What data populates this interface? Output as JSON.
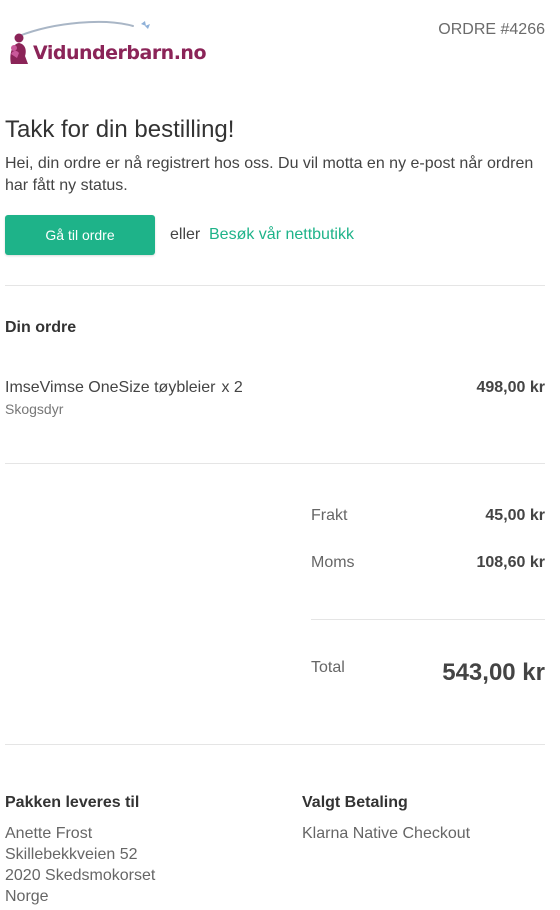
{
  "header": {
    "logo_text": "Vidunderbarn.no",
    "order_number": "ORDRE #4266"
  },
  "intro": {
    "title": "Takk for din bestilling!",
    "message": "Hei, din ordre er nå registrert hos oss. Du vil motta en ny e-post når ordren har fått ny status.",
    "button_label": "Gå til ordre",
    "or_text": "eller",
    "shop_link_label": "Besøk vår nettbutikk"
  },
  "order": {
    "section_title": "Din ordre",
    "items": [
      {
        "name": "ImseVimse OneSize tøybleier",
        "quantity": "x 2",
        "variant": "Skogsdyr",
        "price": "498,00 kr"
      }
    ]
  },
  "summary": {
    "shipping_label": "Frakt",
    "shipping_value": "45,00 kr",
    "vat_label": "Moms",
    "vat_value": "108,60 kr",
    "total_label": "Total",
    "total_value": "543,00 kr"
  },
  "shipping_address": {
    "title": "Pakken leveres til",
    "lines": [
      "Anette Frost",
      "Skillebekkveien 52",
      "2020 Skedsmokorset",
      "Norge"
    ]
  },
  "payment": {
    "title": "Valgt Betaling",
    "method": "Klarna Native Checkout"
  },
  "colors": {
    "brand": "#8b2458",
    "accent": "#1eb389",
    "divider": "#e5e5e5"
  }
}
